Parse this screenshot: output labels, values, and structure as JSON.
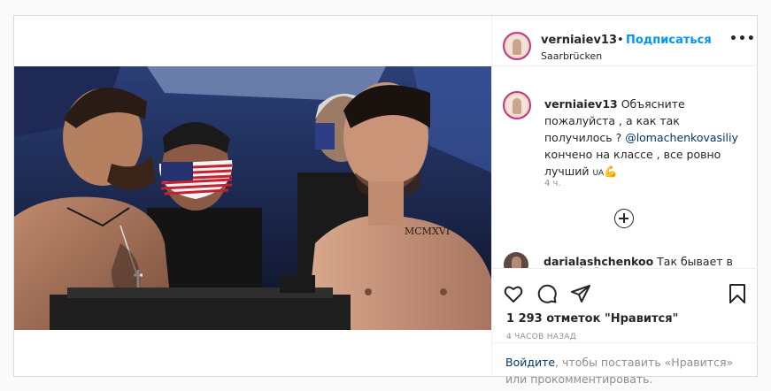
{
  "post": {
    "username": "verniaiev13",
    "separator": "•",
    "follow_label": "Подписаться",
    "location": "Saarbrücken",
    "more_label": "•••",
    "photo": {
      "tattoo_text": "MCMXVI"
    },
    "caption": {
      "username": "verniaiev13",
      "text_part1": " Объясните пожалуйста , а как так получилось ? ",
      "mention": "@lomachenkovasiliy",
      "text_part2": " кончено на классе , все ровно лучший ",
      "tag": "UA",
      "emoji": "💪",
      "time": "4 ч."
    },
    "load_more_icon": "plus-circle-icon",
    "comments": [
      {
        "username": "darialashchenkoo",
        "text": " Так бывает в",
        "emoji": "🙏 😊"
      }
    ],
    "actions": {
      "like_icon": "heart-icon",
      "comment_icon": "comment-icon",
      "share_icon": "share-icon",
      "save_icon": "bookmark-icon"
    },
    "likes": "1 293 отметок \"Нравится\"",
    "time_ago": "4 ЧАСОВ НАЗАД",
    "login": {
      "link": "Войдите",
      "text": ", чтобы поставить «Нравится» или прокомментировать."
    }
  },
  "colors": {
    "link_blue": "#0095f6",
    "mention_blue": "#00376b",
    "muted": "#8e8e8e",
    "text": "#262626"
  }
}
